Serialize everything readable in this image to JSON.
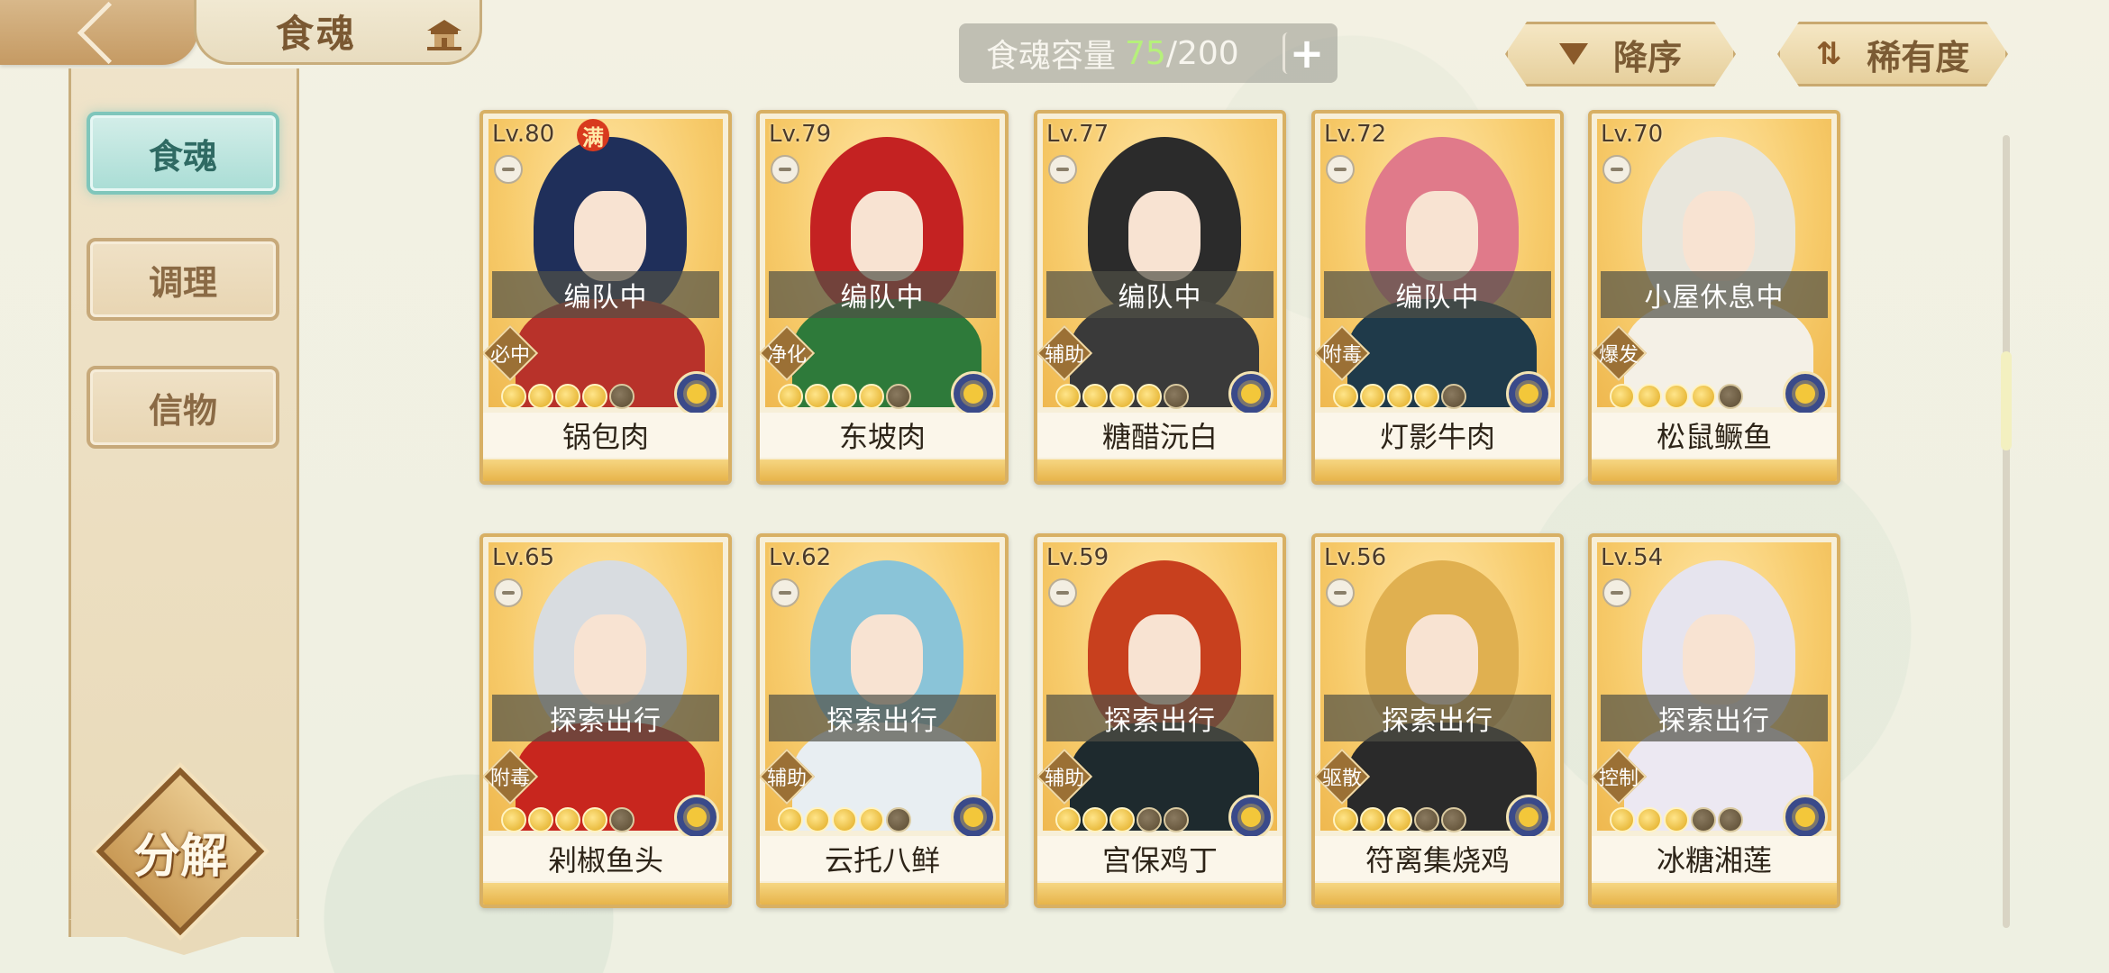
{
  "header": {
    "title": "食魂"
  },
  "sidebar": {
    "tabs": [
      {
        "label": "食魂",
        "active": true
      },
      {
        "label": "调理",
        "active": false
      },
      {
        "label": "信物",
        "active": false
      }
    ],
    "decompose_label": "分解"
  },
  "capacity": {
    "label": "食魂容量",
    "current": "75",
    "separator": "/",
    "max": "200",
    "plus_label": "+"
  },
  "sort": {
    "order_label": "降序",
    "rarity_label": "稀有度"
  },
  "cards": [
    {
      "level": "Lv.80",
      "full": "满",
      "status": "编队中",
      "role": "必中",
      "name": "锅包肉",
      "stars": 4,
      "hair": "#1f2f5a",
      "body": "#b8322a"
    },
    {
      "level": "Lv.79",
      "status": "编队中",
      "role": "净化",
      "name": "东坡肉",
      "stars": 4,
      "hair": "#c42222",
      "body": "#2e7a3a"
    },
    {
      "level": "Lv.77",
      "status": "编队中",
      "role": "辅助",
      "name": "糖醋沅白",
      "stars": 4,
      "hair": "#2b2b2b",
      "body": "#3a3a3a"
    },
    {
      "level": "Lv.72",
      "status": "编队中",
      "role": "附毒",
      "name": "灯影牛肉",
      "stars": 4,
      "hair": "#e07a8a",
      "body": "#1f3a4a"
    },
    {
      "level": "Lv.70",
      "status": "小屋休息中",
      "role": "爆发",
      "name": "松鼠鳜鱼",
      "stars": 4,
      "hair": "#e8e6dc",
      "body": "#f4f0e6"
    },
    {
      "level": "Lv.65",
      "status": "探索出行",
      "role": "附毒",
      "name": "剁椒鱼头",
      "stars": 4,
      "hair": "#d8dce0",
      "body": "#c8261e"
    },
    {
      "level": "Lv.62",
      "status": "探索出行",
      "role": "辅助",
      "name": "云托八鲜",
      "stars": 4,
      "hair": "#8ac4d8",
      "body": "#e8eef2"
    },
    {
      "level": "Lv.59",
      "status": "探索出行",
      "role": "辅助",
      "name": "宫保鸡丁",
      "stars": 3,
      "hair": "#c8401e",
      "body": "#1e2a2e"
    },
    {
      "level": "Lv.56",
      "status": "探索出行",
      "role": "驱散",
      "name": "符离集烧鸡",
      "stars": 3,
      "hair": "#e0b050",
      "body": "#2a2a2a"
    },
    {
      "level": "Lv.54",
      "status": "探索出行",
      "role": "控制",
      "name": "冰糖湘莲",
      "stars": 3,
      "hair": "#e6e4ee",
      "body": "#ece8f2"
    }
  ]
}
